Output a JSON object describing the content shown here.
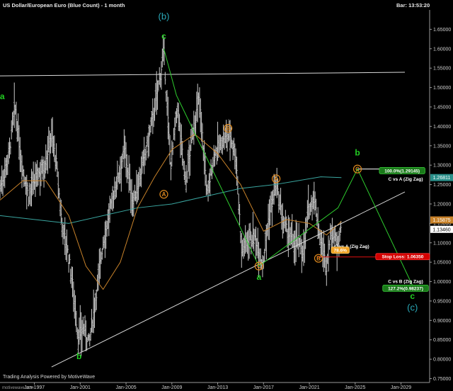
{
  "header": {
    "title": "US Dollar/European Euro (Blue Count) - 1 month",
    "bar_time": "Bar: 13:53:20"
  },
  "footer": {
    "text": "Trading Analysis Powered by MotiveWave",
    "watermark": "motivewave.com"
  },
  "colors": {
    "background": "#000000",
    "price_bars": "#c8c8c8",
    "ma_orange": "#c8822a",
    "ma_teal": "#3aa6a0",
    "zigzag": "#2ecc2e",
    "trendline": "#d8d8d8",
    "stop_line": "#e01010",
    "wave_green": "#22cc22",
    "wave_cyan": "#2aa9b8",
    "wave_orange": "#e08a1e"
  },
  "chart_data": {
    "type": "line",
    "title": "US Dollar/European Euro (Blue Count) - 1 month",
    "y_axis_labels": [
      "1.65000",
      "1.60000",
      "1.55000",
      "1.50000",
      "1.45000",
      "1.40000",
      "1.35000",
      "1.30000",
      "1.25000",
      "1.20000",
      "1.15000",
      "1.10000",
      "1.05000",
      "1.00000",
      "0.95000",
      "0.90000",
      "0.85000",
      "0.80000",
      "0.75000"
    ],
    "ylim": [
      0.74,
      1.7
    ],
    "x_axis_labels": [
      "Jan-1997",
      "Jan-2001",
      "Jan-2005",
      "Jan-2009",
      "Jan-2013",
      "Jan-2017",
      "Jan-2021",
      "Jan-2025",
      "Jan-2029"
    ],
    "xlim": [
      1994.0,
      2031.5
    ],
    "price_path": [
      {
        "x": 1994.0,
        "y": 1.24
      },
      {
        "x": 1994.8,
        "y": 1.33
      },
      {
        "x": 1995.3,
        "y": 1.45
      },
      {
        "x": 1995.9,
        "y": 1.3
      },
      {
        "x": 1996.5,
        "y": 1.22
      },
      {
        "x": 1997.2,
        "y": 1.27
      },
      {
        "x": 1997.9,
        "y": 1.3
      },
      {
        "x": 1998.5,
        "y": 1.38
      },
      {
        "x": 1998.9,
        "y": 1.31
      },
      {
        "x": 1999.4,
        "y": 1.15
      },
      {
        "x": 1999.9,
        "y": 1.08
      },
      {
        "x": 2000.4,
        "y": 0.98
      },
      {
        "x": 2000.8,
        "y": 0.86
      },
      {
        "x": 2001.3,
        "y": 0.88
      },
      {
        "x": 2001.8,
        "y": 0.84
      },
      {
        "x": 2002.4,
        "y": 0.97
      },
      {
        "x": 2003.0,
        "y": 1.1
      },
      {
        "x": 2003.6,
        "y": 1.18
      },
      {
        "x": 2004.2,
        "y": 1.26
      },
      {
        "x": 2004.9,
        "y": 1.34
      },
      {
        "x": 2005.6,
        "y": 1.2
      },
      {
        "x": 2006.3,
        "y": 1.28
      },
      {
        "x": 2007.0,
        "y": 1.37
      },
      {
        "x": 2007.7,
        "y": 1.48
      },
      {
        "x": 2008.3,
        "y": 1.59
      },
      {
        "x": 2008.9,
        "y": 1.3
      },
      {
        "x": 2009.5,
        "y": 1.45
      },
      {
        "x": 2010.2,
        "y": 1.25
      },
      {
        "x": 2010.9,
        "y": 1.4
      },
      {
        "x": 2011.4,
        "y": 1.47
      },
      {
        "x": 2012.1,
        "y": 1.22
      },
      {
        "x": 2012.7,
        "y": 1.33
      },
      {
        "x": 2013.4,
        "y": 1.36
      },
      {
        "x": 2014.1,
        "y": 1.38
      },
      {
        "x": 2014.6,
        "y": 1.32
      },
      {
        "x": 2015.1,
        "y": 1.08
      },
      {
        "x": 2015.8,
        "y": 1.12
      },
      {
        "x": 2016.5,
        "y": 1.1
      },
      {
        "x": 2016.9,
        "y": 1.04
      },
      {
        "x": 2017.5,
        "y": 1.17
      },
      {
        "x": 2018.1,
        "y": 1.25
      },
      {
        "x": 2018.7,
        "y": 1.15
      },
      {
        "x": 2019.4,
        "y": 1.11
      },
      {
        "x": 2020.0,
        "y": 1.1
      },
      {
        "x": 2020.5,
        "y": 1.08
      },
      {
        "x": 2020.9,
        "y": 1.18
      },
      {
        "x": 2021.4,
        "y": 1.22
      },
      {
        "x": 2022.0,
        "y": 1.1
      },
      {
        "x": 2022.5,
        "y": 1.04
      },
      {
        "x": 2022.9,
        "y": 1.13
      },
      {
        "x": 2023.4,
        "y": 1.1
      },
      {
        "x": 2023.8,
        "y": 1.135
      }
    ],
    "ma_orange": [
      {
        "x": 1994.0,
        "y": 1.21
      },
      {
        "x": 1996.0,
        "y": 1.26
      },
      {
        "x": 1998.0,
        "y": 1.26
      },
      {
        "x": 2000.0,
        "y": 1.17
      },
      {
        "x": 2001.5,
        "y": 1.04
      },
      {
        "x": 2003.0,
        "y": 0.98
      },
      {
        "x": 2004.5,
        "y": 1.05
      },
      {
        "x": 2006.0,
        "y": 1.19
      },
      {
        "x": 2007.5,
        "y": 1.27
      },
      {
        "x": 2009.0,
        "y": 1.34
      },
      {
        "x": 2011.0,
        "y": 1.38
      },
      {
        "x": 2013.0,
        "y": 1.33
      },
      {
        "x": 2015.0,
        "y": 1.25
      },
      {
        "x": 2017.0,
        "y": 1.13
      },
      {
        "x": 2019.0,
        "y": 1.16
      },
      {
        "x": 2021.0,
        "y": 1.15
      },
      {
        "x": 2022.5,
        "y": 1.12
      },
      {
        "x": 2023.8,
        "y": 1.155
      }
    ],
    "ma_teal": [
      {
        "x": 1994.0,
        "y": 1.17
      },
      {
        "x": 1997.0,
        "y": 1.16
      },
      {
        "x": 2000.0,
        "y": 1.15
      },
      {
        "x": 2003.0,
        "y": 1.17
      },
      {
        "x": 2006.0,
        "y": 1.19
      },
      {
        "x": 2009.0,
        "y": 1.2
      },
      {
        "x": 2012.0,
        "y": 1.22
      },
      {
        "x": 2015.0,
        "y": 1.24
      },
      {
        "x": 2018.0,
        "y": 1.25
      },
      {
        "x": 2020.0,
        "y": 1.26
      },
      {
        "x": 2022.0,
        "y": 1.27
      },
      {
        "x": 2023.8,
        "y": 1.268
      }
    ],
    "zigzag": [
      {
        "x": 2008.3,
        "y": 1.6
      },
      {
        "x": 2009.4,
        "y": 1.48
      },
      {
        "x": 2016.6,
        "y": 1.04
      },
      {
        "x": 2023.5,
        "y": 1.19
      },
      {
        "x": 2025.2,
        "y": 1.29
      },
      {
        "x": 2030.0,
        "y": 0.99
      }
    ],
    "trendlines": [
      {
        "from": {
          "x": 1994.0,
          "y": 1.53
        },
        "to": {
          "x": 2032.0,
          "y": 1.54
        }
      },
      {
        "from": {
          "x": 1998.5,
          "y": 0.78
        },
        "to": {
          "x": 2032.0,
          "y": 1.27
        }
      }
    ],
    "stop_line": {
      "from": {
        "x": 2021.7,
        "y": 1.0635
      },
      "to": {
        "x": 2032.0,
        "y": 1.0635
      }
    },
    "target_line": {
      "from": {
        "x": 2025.2,
        "y": 1.29
      },
      "to": {
        "x": 2029.0,
        "y": 1.29
      }
    },
    "wave_labels": [
      {
        "text": "a",
        "x": 1994.2,
        "y": 1.47,
        "style": "green"
      },
      {
        "text": "b",
        "x": 2000.9,
        "y": 0.8,
        "style": "green"
      },
      {
        "text": "c",
        "x": 2008.3,
        "y": 1.625,
        "style": "green"
      },
      {
        "text": "(b)",
        "x": 2008.3,
        "y": 1.675,
        "style": "cyan"
      },
      {
        "text": "a",
        "x": 2016.6,
        "y": 1.005,
        "style": "green"
      },
      {
        "text": "b",
        "x": 2025.2,
        "y": 1.325,
        "style": "green"
      },
      {
        "text": "c",
        "x": 2030.0,
        "y": 0.955,
        "style": "green"
      },
      {
        "text": "(c)",
        "x": 2030.0,
        "y": 0.925,
        "style": "cyan"
      }
    ],
    "circled_labels": [
      {
        "text": "A",
        "x": 2008.3,
        "y": 1.225
      },
      {
        "text": "B",
        "x": 2013.9,
        "y": 1.395
      },
      {
        "text": "C",
        "x": 2016.6,
        "y": 1.04
      },
      {
        "text": "A",
        "x": 2018.1,
        "y": 1.265
      },
      {
        "text": "B",
        "x": 2021.8,
        "y": 1.06
      },
      {
        "text": "C",
        "x": 2025.2,
        "y": 1.29
      }
    ],
    "annotations": [
      {
        "text": "C vs A (Zig Zag)",
        "x": 2023.2,
        "y": 1.09,
        "kind": "plain"
      },
      {
        "text": "78.6%",
        "x": 2023.7,
        "y": 1.08,
        "kind": "orange-box"
      },
      {
        "text": "100.0%(1.29145)",
        "x": 2029.1,
        "y": 1.285,
        "kind": "green-box"
      },
      {
        "text": "C vs A (Zig Zag)",
        "x": 2029.4,
        "y": 1.264,
        "kind": "plain"
      },
      {
        "text": "Stop Loss: 1.06350",
        "x": 2029.4,
        "y": 1.0635,
        "kind": "red-box"
      },
      {
        "text": "C vs B (Zig Zag)",
        "x": 2029.4,
        "y": 1.0,
        "kind": "plain"
      },
      {
        "text": "127.2%(0.98237)",
        "x": 2029.4,
        "y": 0.982,
        "kind": "green-box"
      }
    ],
    "price_markers": [
      {
        "text": "1.26811",
        "y": 1.268,
        "kind": "teal"
      },
      {
        "text": "1.15875",
        "y": 1.1588,
        "kind": "orange"
      },
      {
        "text": "1.13460",
        "y": 1.1346,
        "kind": "white"
      }
    ],
    "grid": false
  }
}
